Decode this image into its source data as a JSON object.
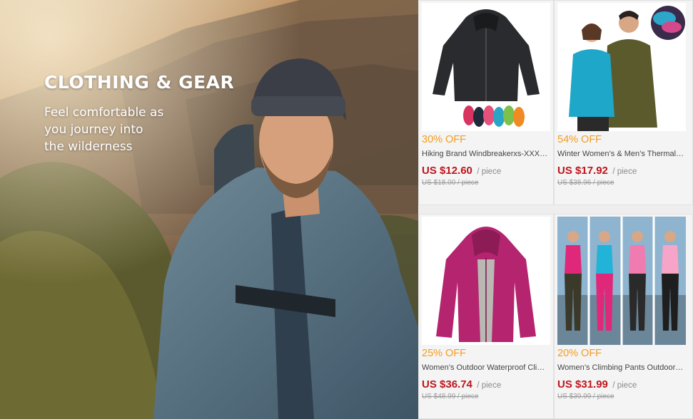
{
  "hero": {
    "title": "CLOTHING & GEAR",
    "subtitle_lines": [
      "Feel comfortable as",
      "you journey into",
      "the wilderness"
    ]
  },
  "products": [
    {
      "discount": "30% OFF",
      "name": "Hiking Brand Windbreakerxs-XXXL ...",
      "price": "US $12.60",
      "unit": "/ piece",
      "old_price": "US $18.00 / piece",
      "image": "black-windbreaker-jacket"
    },
    {
      "discount": "54% OFF",
      "name": "Winter Women’s & Men’s Thermal Fl...",
      "price": "US $17.92",
      "unit": "/ piece",
      "old_price": "US $38.96 / piece",
      "image": "fleece-pullover-couple"
    },
    {
      "discount": "25% OFF",
      "name": "Women’s Outdoor Waterproof Clim...",
      "price": "US $36.74",
      "unit": "/ piece",
      "old_price": "US $48.99 / piece",
      "image": "magenta-softshell-jacket"
    },
    {
      "discount": "20% OFF",
      "name": "Women’s Climbing Pants Outdoor L...",
      "price": "US $31.99",
      "unit": "/ piece",
      "old_price": "US $39.99 / piece",
      "image": "women-climbing-pants-models"
    }
  ],
  "colors": {
    "discount": "#f39c1f",
    "price": "#c0141b",
    "muted": "#9a9a9a"
  }
}
